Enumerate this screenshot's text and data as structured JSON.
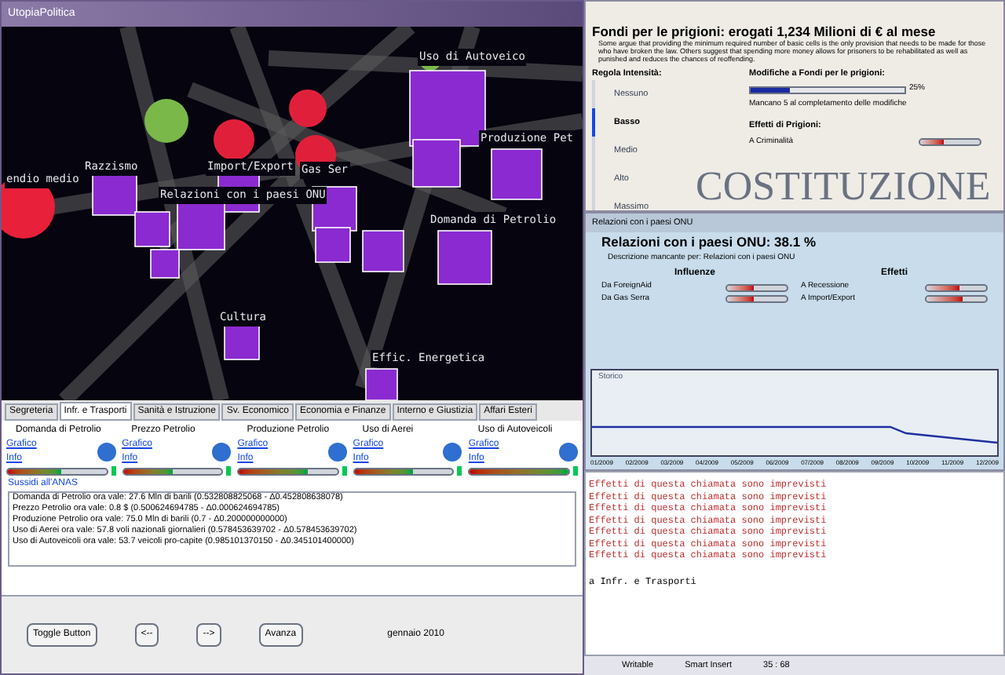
{
  "main_window": {
    "title": "UtopiaPolitica"
  },
  "graph": {
    "labels": [
      "Uso di Autoveico",
      "Razzismo",
      "Import/Export",
      "Gas Ser",
      "endio medio",
      "Relazioni con i paesi ONU",
      "Produzione Pet",
      "Domanda di Petrolio",
      "Cultura",
      "Effic. Energetica"
    ]
  },
  "tabs": [
    {
      "label": "Segreteria",
      "selected": false
    },
    {
      "label": "Infr. e Trasporti",
      "selected": true
    },
    {
      "label": "Sanità e Istruzione",
      "selected": false
    },
    {
      "label": "Sv. Economico",
      "selected": false
    },
    {
      "label": "Economia e Finanze",
      "selected": false
    },
    {
      "label": "Interno e Giustizia",
      "selected": false
    },
    {
      "label": "Affari Esteri",
      "selected": false
    }
  ],
  "indicators": [
    {
      "name": "Domanda di Petrolio",
      "links": [
        "Grafico",
        "Info"
      ],
      "level": 0.55
    },
    {
      "name": "Prezzo Petrolio",
      "links": [
        "Grafico",
        "Info"
      ],
      "level": 0.5
    },
    {
      "name": "Produzione Petrolio",
      "links": [
        "Grafico",
        "Info"
      ],
      "level": 0.7
    },
    {
      "name": "Uso di Aerei",
      "links": [
        "Grafico",
        "Info"
      ],
      "level": 0.6
    },
    {
      "name": "Uso di Autoveicoli",
      "links": [
        "Grafico",
        "Info"
      ],
      "level": 1
    }
  ],
  "log": {
    "heading": "Sussidi all'ANAS",
    "lines": [
      "Domanda di Petrolio ora vale: 27.6 Mln di barili (0.532808825068 - Δ0.452808638078)",
      "Prezzo Petrolio ora vale: 0.8 $ (0.500624694785 - Δ0.000624694785)",
      "Produzione Petrolio ora vale: 75.0 Mln di barili (0.7 - Δ0.200000000000)",
      "Uso di Aerei ora vale: 57.8 voli nazionali giornalieri (0.578453639702 - Δ0.578453639702)",
      "Uso di Autoveicoli ora vale: 53.7 veicoli pro-capite (0.985101370150 - Δ0.345101400000)"
    ]
  },
  "controls": {
    "buttons": [
      "Toggle Button",
      "<--",
      "-->",
      "Avanza"
    ],
    "date": "gennaio 2010"
  },
  "policy_window": {
    "heading": "Fondi per le prigioni: erogati 1,234 Milioni di € al mese",
    "description": "Some argue that providing the minimum required number of basic cells is the only provision that needs to be made for those who have broken the law. Others suggest that spending more money allows for prisoners to be rehabilitated as well as punished and reduces the chances of reoffending.",
    "intensity_label": "Regola Intensità:",
    "intensities": [
      {
        "label": "Nessuno",
        "selected": false
      },
      {
        "label": "Basso",
        "selected": true
      },
      {
        "label": "Medio",
        "selected": false
      },
      {
        "label": "Alto",
        "selected": false
      },
      {
        "label": "Massimo",
        "selected": false
      }
    ],
    "changes_label": "Modifiche a Fondi per le prigioni:",
    "progress": {
      "level": 0.25,
      "reading": "25%"
    },
    "remaining": "Mancano 5 al completamento delle modifiche",
    "effects_label": "Effetti di Prigioni:",
    "effects": [
      {
        "name": "A Criminalità",
        "level": 0.4
      }
    ],
    "background_text": "COSTITUZIONE"
  },
  "relations_window": {
    "title": "Relazioni con i paesi ONU",
    "heading": "Relazioni con i paesi ONU: 38.1 %",
    "description": "Descrizione mancante per: Relazioni con i paesi ONU",
    "influences_label": "Influenze",
    "influences": [
      {
        "name": "Da ForeignAid",
        "level": 0.45
      },
      {
        "name": "Da Gas Serra",
        "level": 0.45
      }
    ],
    "effects_label": "Effetti",
    "effects": [
      {
        "name": "A Recessione",
        "level": 0.55
      },
      {
        "name": "A Import/Export",
        "level": 0.6
      }
    ],
    "chart_title": "Storico",
    "x_labels": [
      "01/2009",
      "02/2009",
      "03/2009",
      "04/2009",
      "05/2009",
      "06/2009",
      "07/2009",
      "08/2009",
      "09/2009",
      "10/2009",
      "11/2009",
      "12/2009"
    ]
  },
  "console": {
    "lines": [
      "Effetti di questa chiamata sono imprevisti",
      "Effetti di questa chiamata sono imprevisti",
      "Effetti di questa chiamata sono imprevisti",
      "Effetti di questa chiamata sono imprevisti",
      "Effetti di questa chiamata sono imprevisti",
      "Effetti di questa chiamata sono imprevisti",
      "Effetti di questa chiamata sono imprevisti"
    ],
    "footer": "a Infr. e Trasporti"
  },
  "status_bar": [
    "Writable",
    "Smart Insert",
    "35 : 68"
  ]
}
